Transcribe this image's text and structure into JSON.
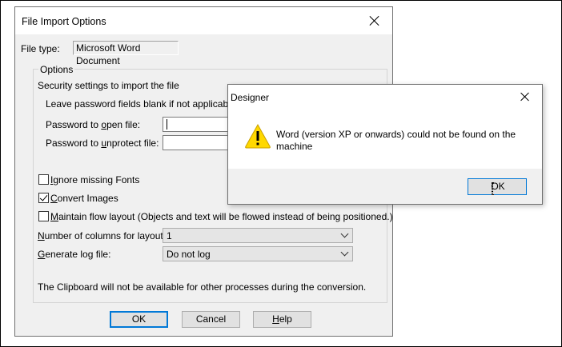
{
  "main_dialog": {
    "title": "File Import Options",
    "file_type_label": "File type:",
    "file_type_value": "Microsoft Word Document",
    "options_group_label": "Options",
    "security_heading": "Security settings to import the file",
    "password_hint": "Leave password fields blank if not applicable.",
    "password_open": {
      "prefix": "Password to ",
      "accel": "o",
      "suffix": "pen file:",
      "value": ""
    },
    "password_unprotect": {
      "prefix": "Password to ",
      "accel": "u",
      "suffix": "nprotect file:",
      "value": ""
    },
    "ignore_fonts": {
      "accel": "I",
      "rest": "gnore missing Fonts",
      "checked": false
    },
    "convert_images": {
      "accel": "C",
      "rest": "onvert Images",
      "checked": true
    },
    "maintain_flow": {
      "accel": "M",
      "rest": "aintain flow layout (Objects and text will be flowed instead of being positioned.)",
      "checked": false
    },
    "columns": {
      "accel": "N",
      "rest": "umber of columns for layout:",
      "value": "1"
    },
    "log_file": {
      "accel": "G",
      "rest": "enerate log file:",
      "value": "Do not log"
    },
    "clipboard_note": "The Clipboard will not be available for other processes during the conversion.",
    "ok_label": "OK",
    "cancel_label": "Cancel",
    "help": {
      "accel": "H",
      "rest": "elp"
    }
  },
  "error_dialog": {
    "title": "Designer",
    "message": "Word (version XP or onwards) could not be found on the machine",
    "ok_label": "OK",
    "icon": "warning-icon",
    "warning_color": "#ffd800"
  },
  "colors": {
    "dialog_bg": "#f0f0f0",
    "focus_border": "#0078d7"
  }
}
